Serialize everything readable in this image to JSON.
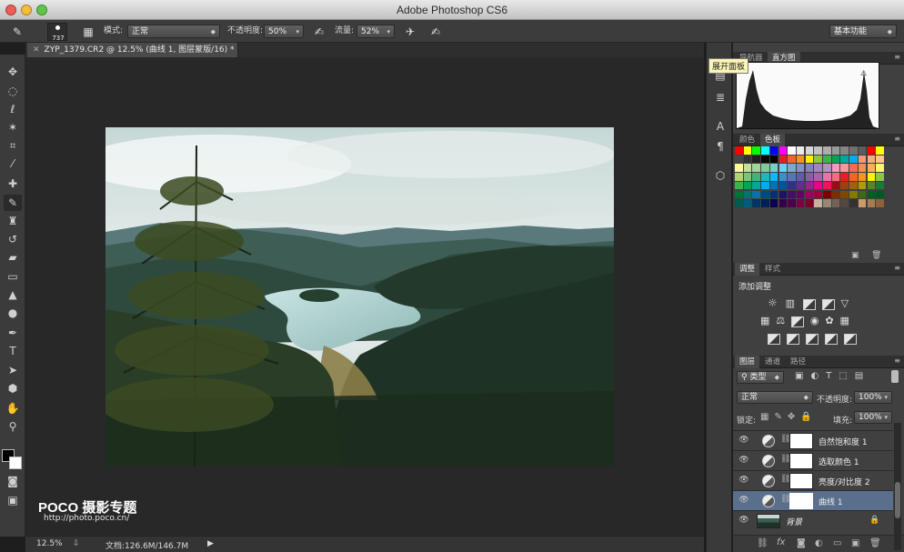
{
  "window": {
    "title": "Adobe Photoshop CS6"
  },
  "options_bar": {
    "brush_size": "737",
    "mode_label": "模式:",
    "mode_value": "正常",
    "opacity_label": "不透明度:",
    "opacity_value": "50%",
    "flow_label": "流量:",
    "flow_value": "52%",
    "workspace": "基本功能"
  },
  "document": {
    "tab_label": "ZYP_1379.CR2 @ 12.5% (曲线 1, 图层蒙版/16) *"
  },
  "status_bar": {
    "zoom": "12.5%",
    "doc_info": "文档:126.6M/146.7M"
  },
  "watermark": {
    "logo": "POCO 摄影专题",
    "url": "http://photo.poco.cn/"
  },
  "tooltip": "展开面板",
  "panels": {
    "top_tabs": [
      "导航器",
      "直方图"
    ],
    "color_tabs": [
      "颜色",
      "色板"
    ],
    "adjust_tabs": [
      "调整",
      "样式"
    ],
    "adjust_title": "添加调整",
    "layer_tabs": [
      "图层",
      "通道",
      "路径"
    ],
    "layer_kind": "类型",
    "blend_mode": "正常",
    "opacity_label": "不透明度:",
    "opacity_value": "100%",
    "lock_label": "锁定:",
    "fill_label": "填充:",
    "fill_value": "100%",
    "layers": [
      {
        "name": "自然饱和度 1",
        "type": "adjustment"
      },
      {
        "name": "选取颜色 1",
        "type": "adjustment"
      },
      {
        "name": "亮度/对比度 2",
        "type": "adjustment"
      },
      {
        "name": "曲线 1",
        "type": "adjustment",
        "selected": true
      },
      {
        "name": "背景",
        "type": "background"
      }
    ]
  },
  "colors": {
    "accent_selected_layer": "#5a6f8c",
    "panel_bg": "#404040",
    "canvas_bg": "#282828"
  }
}
